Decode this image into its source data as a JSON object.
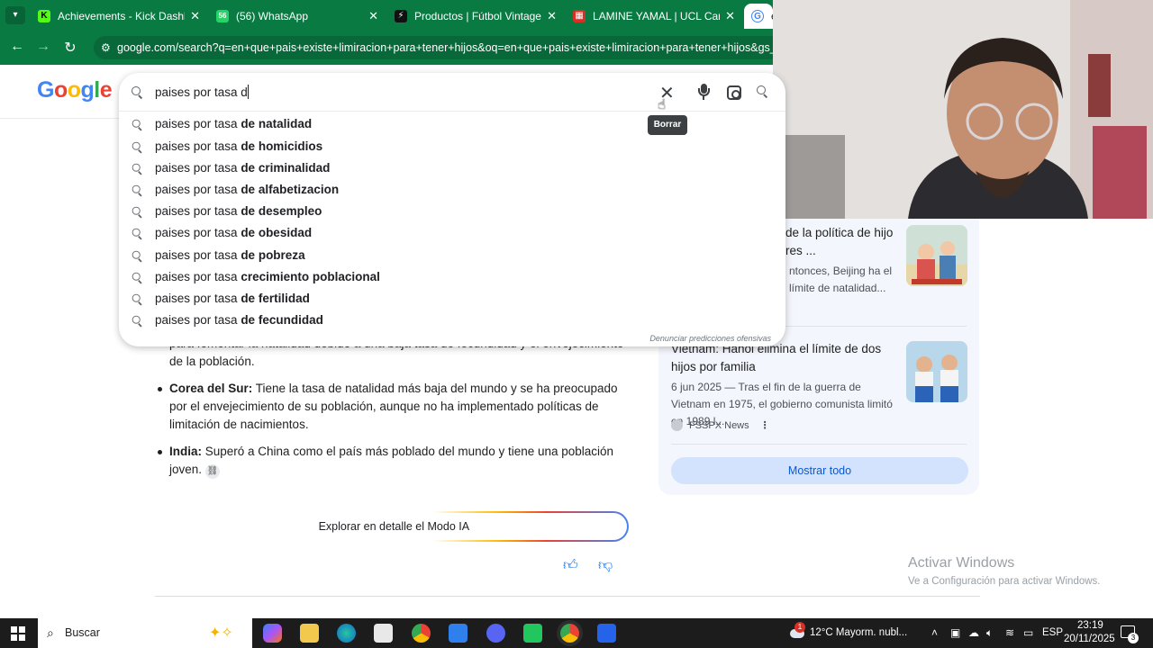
{
  "browser": {
    "tabs": [
      {
        "title": "Achievements - Kick Dashboard",
        "icon": "kick-icon",
        "color": "#53fc18",
        "glyph": "K"
      },
      {
        "title": "(56) WhatsApp",
        "icon": "whatsapp-icon",
        "color": "#25d366",
        "glyph": "56"
      },
      {
        "title": "Productos | Fútbol Vintage",
        "icon": "futbol-vintage-icon",
        "color": "#111111",
        "glyph": "⚡"
      },
      {
        "title": "LAMINE YAMAL | UCL Camiseta",
        "icon": "camiseta-icon",
        "color": "#d93025",
        "glyph": "▦"
      },
      {
        "title": "e",
        "icon": "google-icon",
        "color": "#ffffff",
        "glyph": "G"
      }
    ],
    "url": "google.com/search?q=en+que+pais+existe+limiracion+para+tener+hijos&oq=en+que+pais+existe+limiracion+para+tener+hijos&gs_lcrp=",
    "chrome_color": "#0a7a43"
  },
  "search": {
    "query": "paises por tasa d",
    "suggestion_prefix": "paises por tasa ",
    "suggestions": [
      "de natalidad",
      "de homicidios",
      "de criminalidad",
      "de alfabetizacion",
      "de desempleo",
      "de obesidad",
      "de pobreza",
      "crecimiento poblacional",
      "de fertilidad",
      "de fecundidad"
    ],
    "report_link": "Denunciar predicciones ofensivas",
    "clear_tooltip": "Borrar"
  },
  "ai_overview": {
    "partial_text": "para fomentar la natalidad debido a una baja tasa de fecundidad y el envejecimiento de la población.",
    "items": [
      {
        "title": "Corea del Sur:",
        "text": " Tiene la tasa de natalidad más baja del mundo y se ha preocupado por el envejecimiento de su población, aunque no ha implementado políticas de limitación de nacimientos."
      },
      {
        "title": "India:",
        "text": " Superó a China como el país más poblado del mundo y tiene una población joven."
      }
    ],
    "explore_label": "Explorar en detalle el Modo IA"
  },
  "news": {
    "card1": {
      "title": "de la política de hijo res ...",
      "snippet": "ntonces, Beijing ha el límite de natalidad..."
    },
    "card2": {
      "title": "Vietnam: Hanói elimina el límite de dos hijos por familia",
      "snippet": "6 jun 2025 — Tras el fin de la guerra de Vietnam en 1975, el gobierno comunista limitó en 1989 l...",
      "source": "FSSPX News"
    },
    "show_all": "Mostrar todo"
  },
  "watermark": {
    "line1": "Activar Windows",
    "line2": "Ve a Configuración para activar Windows."
  },
  "taskbar": {
    "search_placeholder": "Buscar",
    "weather": "12°C  Mayorm. nubl...",
    "weather_badge": "1",
    "language": "ESP",
    "time": "23:19",
    "date": "20/11/2025",
    "notifications": "3"
  }
}
